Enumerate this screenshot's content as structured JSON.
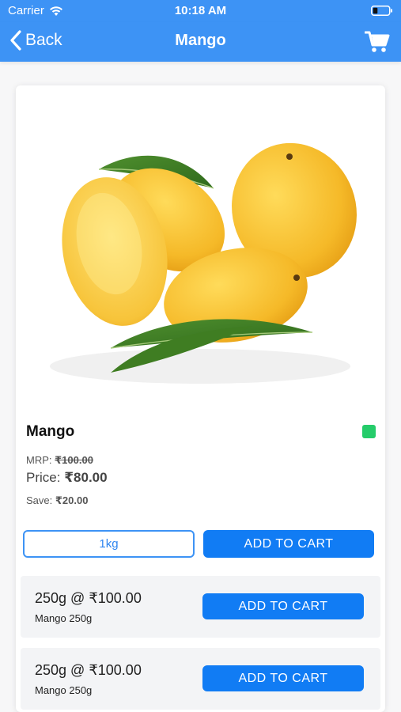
{
  "status_bar": {
    "carrier": "Carrier",
    "time": "10:18 AM"
  },
  "nav": {
    "back_label": "Back",
    "title": "Mango"
  },
  "product": {
    "name": "Mango",
    "mrp_label": "MRP:",
    "mrp_value": "₹100.00",
    "price_label": "Price:",
    "price_value": "₹80.00",
    "save_label": "Save:",
    "save_value": "₹20.00",
    "selected_size": "1kg",
    "add_to_cart_label": "ADD TO CART",
    "veg_color": "#25cc6a"
  },
  "variants": [
    {
      "title": "250g @ ₹100.00",
      "subtitle": "Mango 250g",
      "button_label": "ADD TO CART"
    },
    {
      "title": "250g @ ₹100.00",
      "subtitle": "Mango 250g",
      "button_label": "ADD TO CART"
    }
  ],
  "colors": {
    "primary": "#3d93f5",
    "button": "#117cf4"
  }
}
